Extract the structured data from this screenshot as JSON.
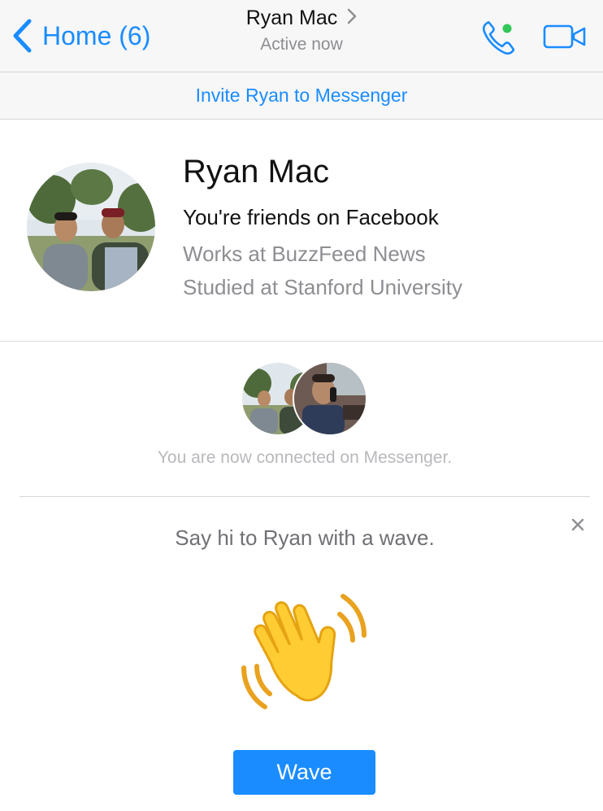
{
  "header": {
    "back_label": "Home (6)",
    "title": "Ryan Mac",
    "subtitle": "Active now",
    "accent_color": "#1a8cff",
    "online_dot_color": "#34c759",
    "icons": [
      "chevron-left-icon",
      "chevron-right-icon",
      "phone-icon",
      "video-camera-icon"
    ]
  },
  "invite": {
    "label": "Invite Ryan to Messenger"
  },
  "profile": {
    "name": "Ryan Mac",
    "friends_text": "You're friends on Facebook",
    "work": "Works at BuzzFeed News",
    "education": "Studied at Stanford University"
  },
  "connection": {
    "text": "You are now connected on Messenger."
  },
  "wave_card": {
    "prompt": "Say hi to Ryan with a wave.",
    "button_label": "Wave",
    "icons": [
      "close-icon",
      "waving-hand-icon"
    ]
  }
}
